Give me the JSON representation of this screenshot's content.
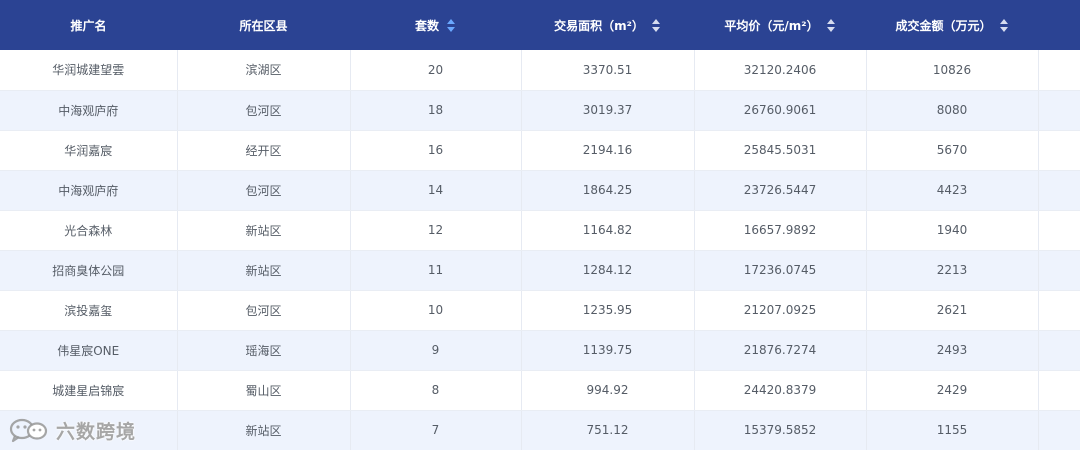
{
  "table": {
    "headers": [
      {
        "label": "推广名",
        "sortable": false,
        "active": false
      },
      {
        "label": "所在区县",
        "sortable": false,
        "active": false
      },
      {
        "label": "套数",
        "sortable": true,
        "active": true
      },
      {
        "label": "交易面积（m²）",
        "sortable": true,
        "active": false
      },
      {
        "label": "平均价（元/m²）",
        "sortable": true,
        "active": false
      },
      {
        "label": "成交金额（万元）",
        "sortable": true,
        "active": false
      }
    ],
    "rows": [
      [
        "华润城建望雲",
        "滨湖区",
        "20",
        "3370.51",
        "32120.2406",
        "10826"
      ],
      [
        "中海观庐府",
        "包河区",
        "18",
        "3019.37",
        "26760.9061",
        "8080"
      ],
      [
        "华润嘉宸",
        "经开区",
        "16",
        "2194.16",
        "25845.5031",
        "5670"
      ],
      [
        "中海观庐府",
        "包河区",
        "14",
        "1864.25",
        "23726.5447",
        "4423"
      ],
      [
        "光合森林",
        "新站区",
        "12",
        "1164.82",
        "16657.9892",
        "1940"
      ],
      [
        "招商臭体公园",
        "新站区",
        "11",
        "1284.12",
        "17236.0745",
        "2213"
      ],
      [
        "滨投嘉玺",
        "包河区",
        "10",
        "1235.95",
        "21207.0925",
        "2621"
      ],
      [
        "伟星宸ONE",
        "瑶海区",
        "9",
        "1139.75",
        "21876.7274",
        "2493"
      ],
      [
        "城建星启锦宸",
        "蜀山区",
        "8",
        "994.92",
        "24420.8379",
        "2429"
      ],
      [
        "",
        "新站区",
        "7",
        "751.12",
        "15379.5852",
        "1155"
      ]
    ]
  },
  "watermark": {
    "text": "六数跨境",
    "icon": "wechat-logo-icon"
  },
  "colors": {
    "header_bg": "#2b4393",
    "stripe_bg": "#eef3fd",
    "sort_active": "#6aa8ff"
  }
}
